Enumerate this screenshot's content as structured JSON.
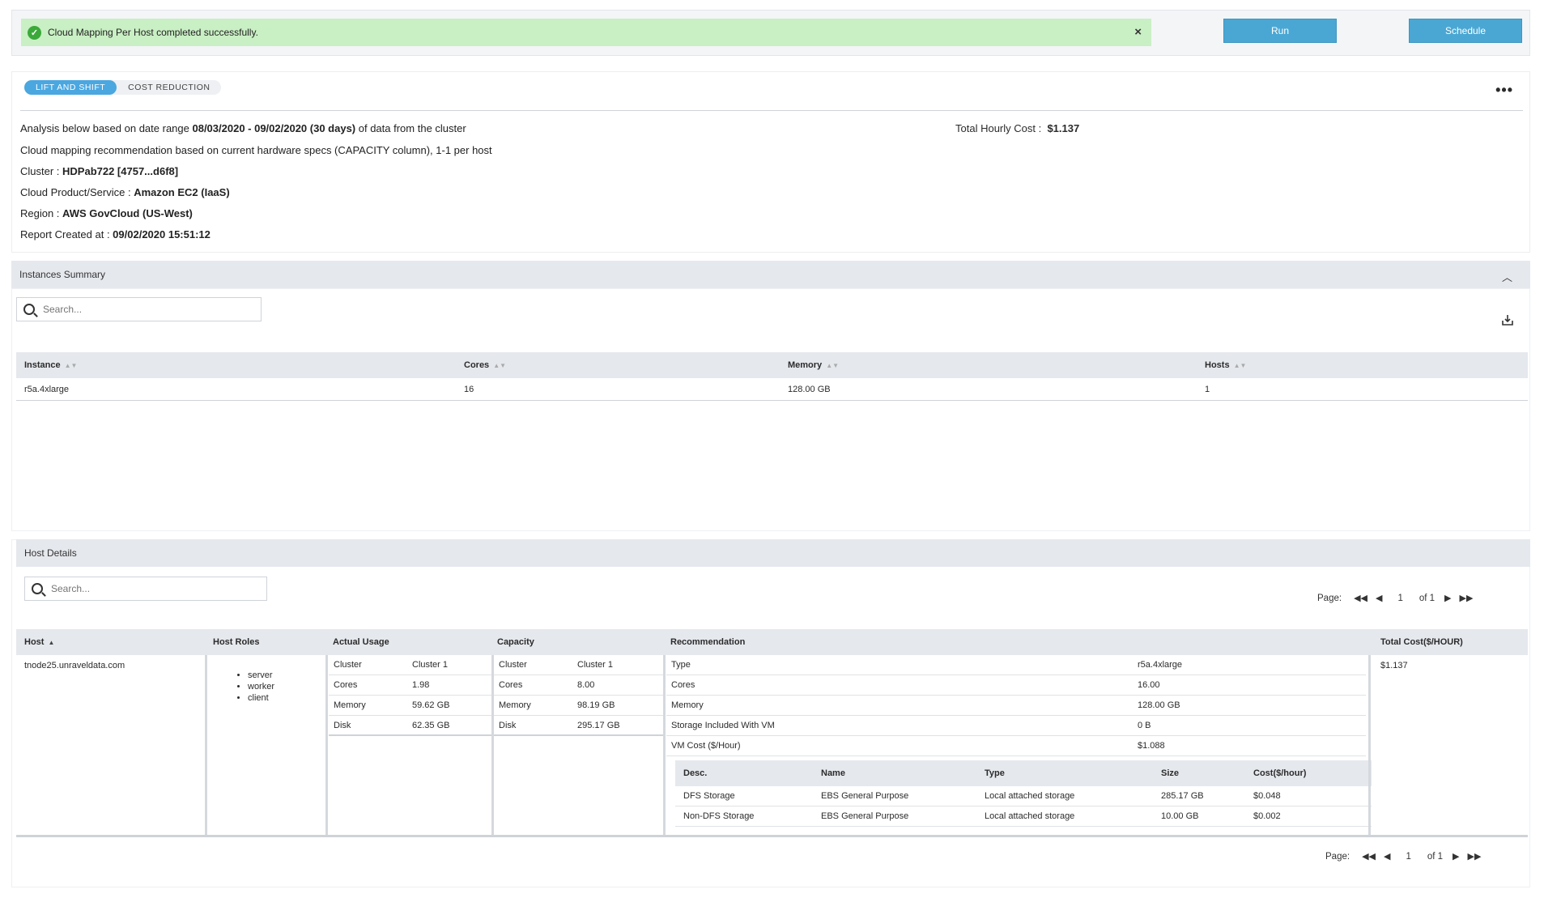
{
  "alert": {
    "message": "Cloud Mapping Per Host completed successfully.",
    "close": "×"
  },
  "actions": {
    "run": "Run",
    "schedule": "Schedule"
  },
  "tabs": [
    {
      "label": "LIFT AND SHIFT",
      "active": true
    },
    {
      "label": "COST REDUCTION",
      "active": false
    }
  ],
  "more_menu": "•••",
  "analysis": {
    "line1_prefix": "Analysis below based on date range ",
    "line1_range": "08/03/2020 - 09/02/2020 (30 days)",
    "line1_suffix": " of data from the cluster",
    "line2": "Cloud mapping recommendation based on current hardware specs (CAPACITY column), 1-1 per host",
    "cluster_label": "Cluster : ",
    "cluster_value": "HDPab722 [4757...d6f8]",
    "service_label": "Cloud Product/Service : ",
    "service_value": "Amazon EC2 (IaaS)",
    "region_label": "Region : ",
    "region_value": "AWS GovCloud (US-West)",
    "created_label": "Report Created at : ",
    "created_value": "09/02/2020 15:51:12",
    "total_cost_label": "Total Hourly Cost : ",
    "total_cost_value": "$1.137"
  },
  "instances_summary": {
    "title": "Instances Summary",
    "search_placeholder": "Search...",
    "columns": [
      "Instance",
      "Cores",
      "Memory",
      "Hosts"
    ],
    "rows": [
      [
        "r5a.4xlarge",
        "16",
        "128.00 GB",
        "1"
      ]
    ]
  },
  "host_details": {
    "title": "Host Details",
    "search_placeholder": "Search...",
    "pager": {
      "label": "Page:",
      "page": "1",
      "of": "of 1"
    },
    "columns": [
      "Host",
      "Host Roles",
      "Actual Usage",
      "Capacity",
      "Recommendation",
      "Total Cost($/HOUR)"
    ],
    "host": "tnode25.unraveldata.com",
    "roles": [
      "server",
      "worker",
      "client"
    ],
    "actual_usage": [
      [
        "Cluster",
        "Cluster 1"
      ],
      [
        "Cores",
        "1.98"
      ],
      [
        "Memory",
        "59.62 GB"
      ],
      [
        "Disk",
        "62.35 GB"
      ]
    ],
    "capacity": [
      [
        "Cluster",
        "Cluster 1"
      ],
      [
        "Cores",
        "8.00"
      ],
      [
        "Memory",
        "98.19 GB"
      ],
      [
        "Disk",
        "295.17 GB"
      ]
    ],
    "recommendation": [
      [
        "Type",
        "r5a.4xlarge"
      ],
      [
        "Cores",
        "16.00"
      ],
      [
        "Memory",
        "128.00 GB"
      ],
      [
        "Storage Included With VM",
        "0 B"
      ],
      [
        "VM Cost ($/Hour)",
        "$1.088"
      ]
    ],
    "storage_columns": [
      "Desc.",
      "Name",
      "Type",
      "Size",
      "Cost($/hour)"
    ],
    "storage_rows": [
      [
        "DFS Storage",
        "EBS General Purpose",
        "Local attached storage",
        "285.17 GB",
        "$0.048"
      ],
      [
        "Non-DFS Storage",
        "EBS General Purpose",
        "Local attached storage",
        "10.00 GB",
        "$0.002"
      ]
    ],
    "total_cost": "$1.137"
  },
  "colors": {
    "success_bg": "#c9efc4",
    "button": "#4aa7d3",
    "tab_active": "#4aa7e0",
    "header_bg": "#e5e8ed"
  }
}
